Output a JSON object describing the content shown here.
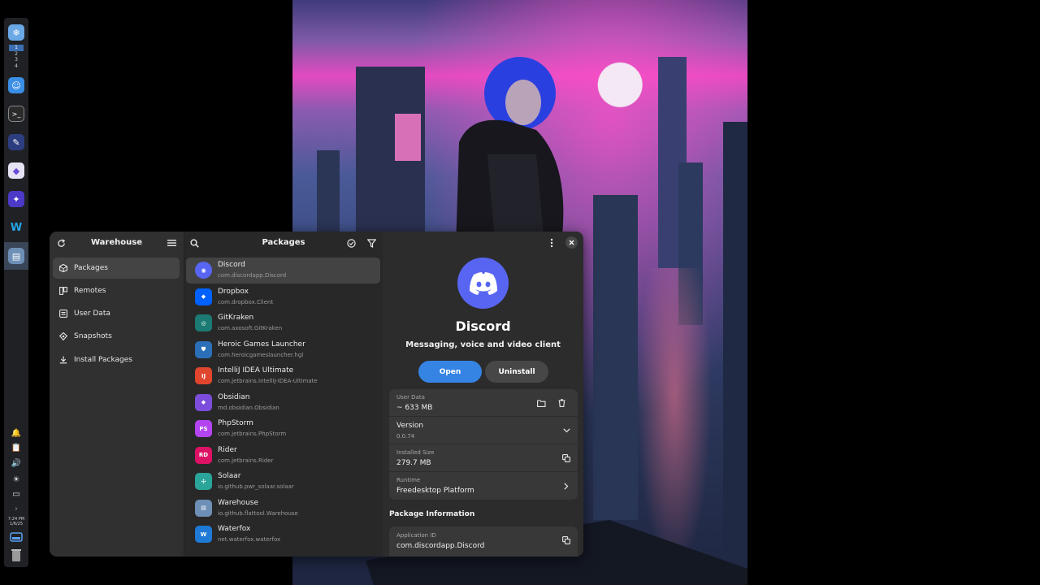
{
  "dock": {
    "workspaces": [
      "1",
      "2",
      "3",
      "4"
    ],
    "active_workspace": "1",
    "apps": [
      "kde-app-icon",
      "finder-icon",
      "terminal-icon",
      "krita-icon",
      "proton-icon",
      "network-app-icon",
      "waterfox-icon",
      "warehouse-icon"
    ],
    "clock_time": "7:24 PM",
    "clock_date": "1/6/25"
  },
  "sidebar": {
    "title": "Warehouse",
    "items": [
      {
        "label": "Packages",
        "icon": "package-icon"
      },
      {
        "label": "Remotes",
        "icon": "remotes-icon"
      },
      {
        "label": "User Data",
        "icon": "userdata-icon"
      },
      {
        "label": "Snapshots",
        "icon": "snapshot-icon"
      },
      {
        "label": "Install Packages",
        "icon": "download-icon"
      }
    ]
  },
  "packages": {
    "title": "Packages",
    "items": [
      {
        "name": "Discord",
        "id": "com.discordapp.Discord",
        "color": "#5865f2"
      },
      {
        "name": "Dropbox",
        "id": "com.dropbox.Client",
        "color": "#0061fe"
      },
      {
        "name": "GitKraken",
        "id": "com.axosoft.GitKraken",
        "color": "#1b7a73"
      },
      {
        "name": "Heroic Games Launcher",
        "id": "com.heroicgameslauncher.hgl",
        "color": "#2a6fb8"
      },
      {
        "name": "IntelliJ IDEA Ultimate",
        "id": "com.jetbrains.IntelliJ-IDEA-Ultimate",
        "color": "#e0462d"
      },
      {
        "name": "Obsidian",
        "id": "md.obsidian.Obsidian",
        "color": "#7c4ddb"
      },
      {
        "name": "PhpStorm",
        "id": "com.jetbrains.PhpStorm",
        "color": "#b345f1"
      },
      {
        "name": "Rider",
        "id": "com.jetbrains.Rider",
        "color": "#dd1265"
      },
      {
        "name": "Solaar",
        "id": "io.github.pwr_solaar.solaar",
        "color": "#2aa59a"
      },
      {
        "name": "Warehouse",
        "id": "io.github.flattool.Warehouse",
        "color": "#6e8fb6"
      },
      {
        "name": "Waterfox",
        "id": "net.waterfox.waterfox",
        "color": "#1e7ad6"
      }
    ],
    "icon_text": {
      "IntelliJ IDEA Ultimate": "IJ",
      "PhpStorm": "PS",
      "Rider": "RD"
    }
  },
  "detail": {
    "app_name": "Discord",
    "summary": "Messaging, voice and video client",
    "open_label": "Open",
    "uninstall_label": "Uninstall",
    "user_data_label": "User Data",
    "user_data_value": "~ 633 MB",
    "version_label": "Version",
    "version_value": "0.0.74",
    "installed_size_label": "Installed Size",
    "installed_size_value": "279.7 MB",
    "runtime_label": "Runtime",
    "runtime_value": "Freedesktop Platform",
    "section_title": "Package Information",
    "app_id_label": "Application ID",
    "app_id_value": "com.discordapp.Discord"
  },
  "colors": {
    "accent": "#3584e4",
    "discord": "#5865f2"
  }
}
